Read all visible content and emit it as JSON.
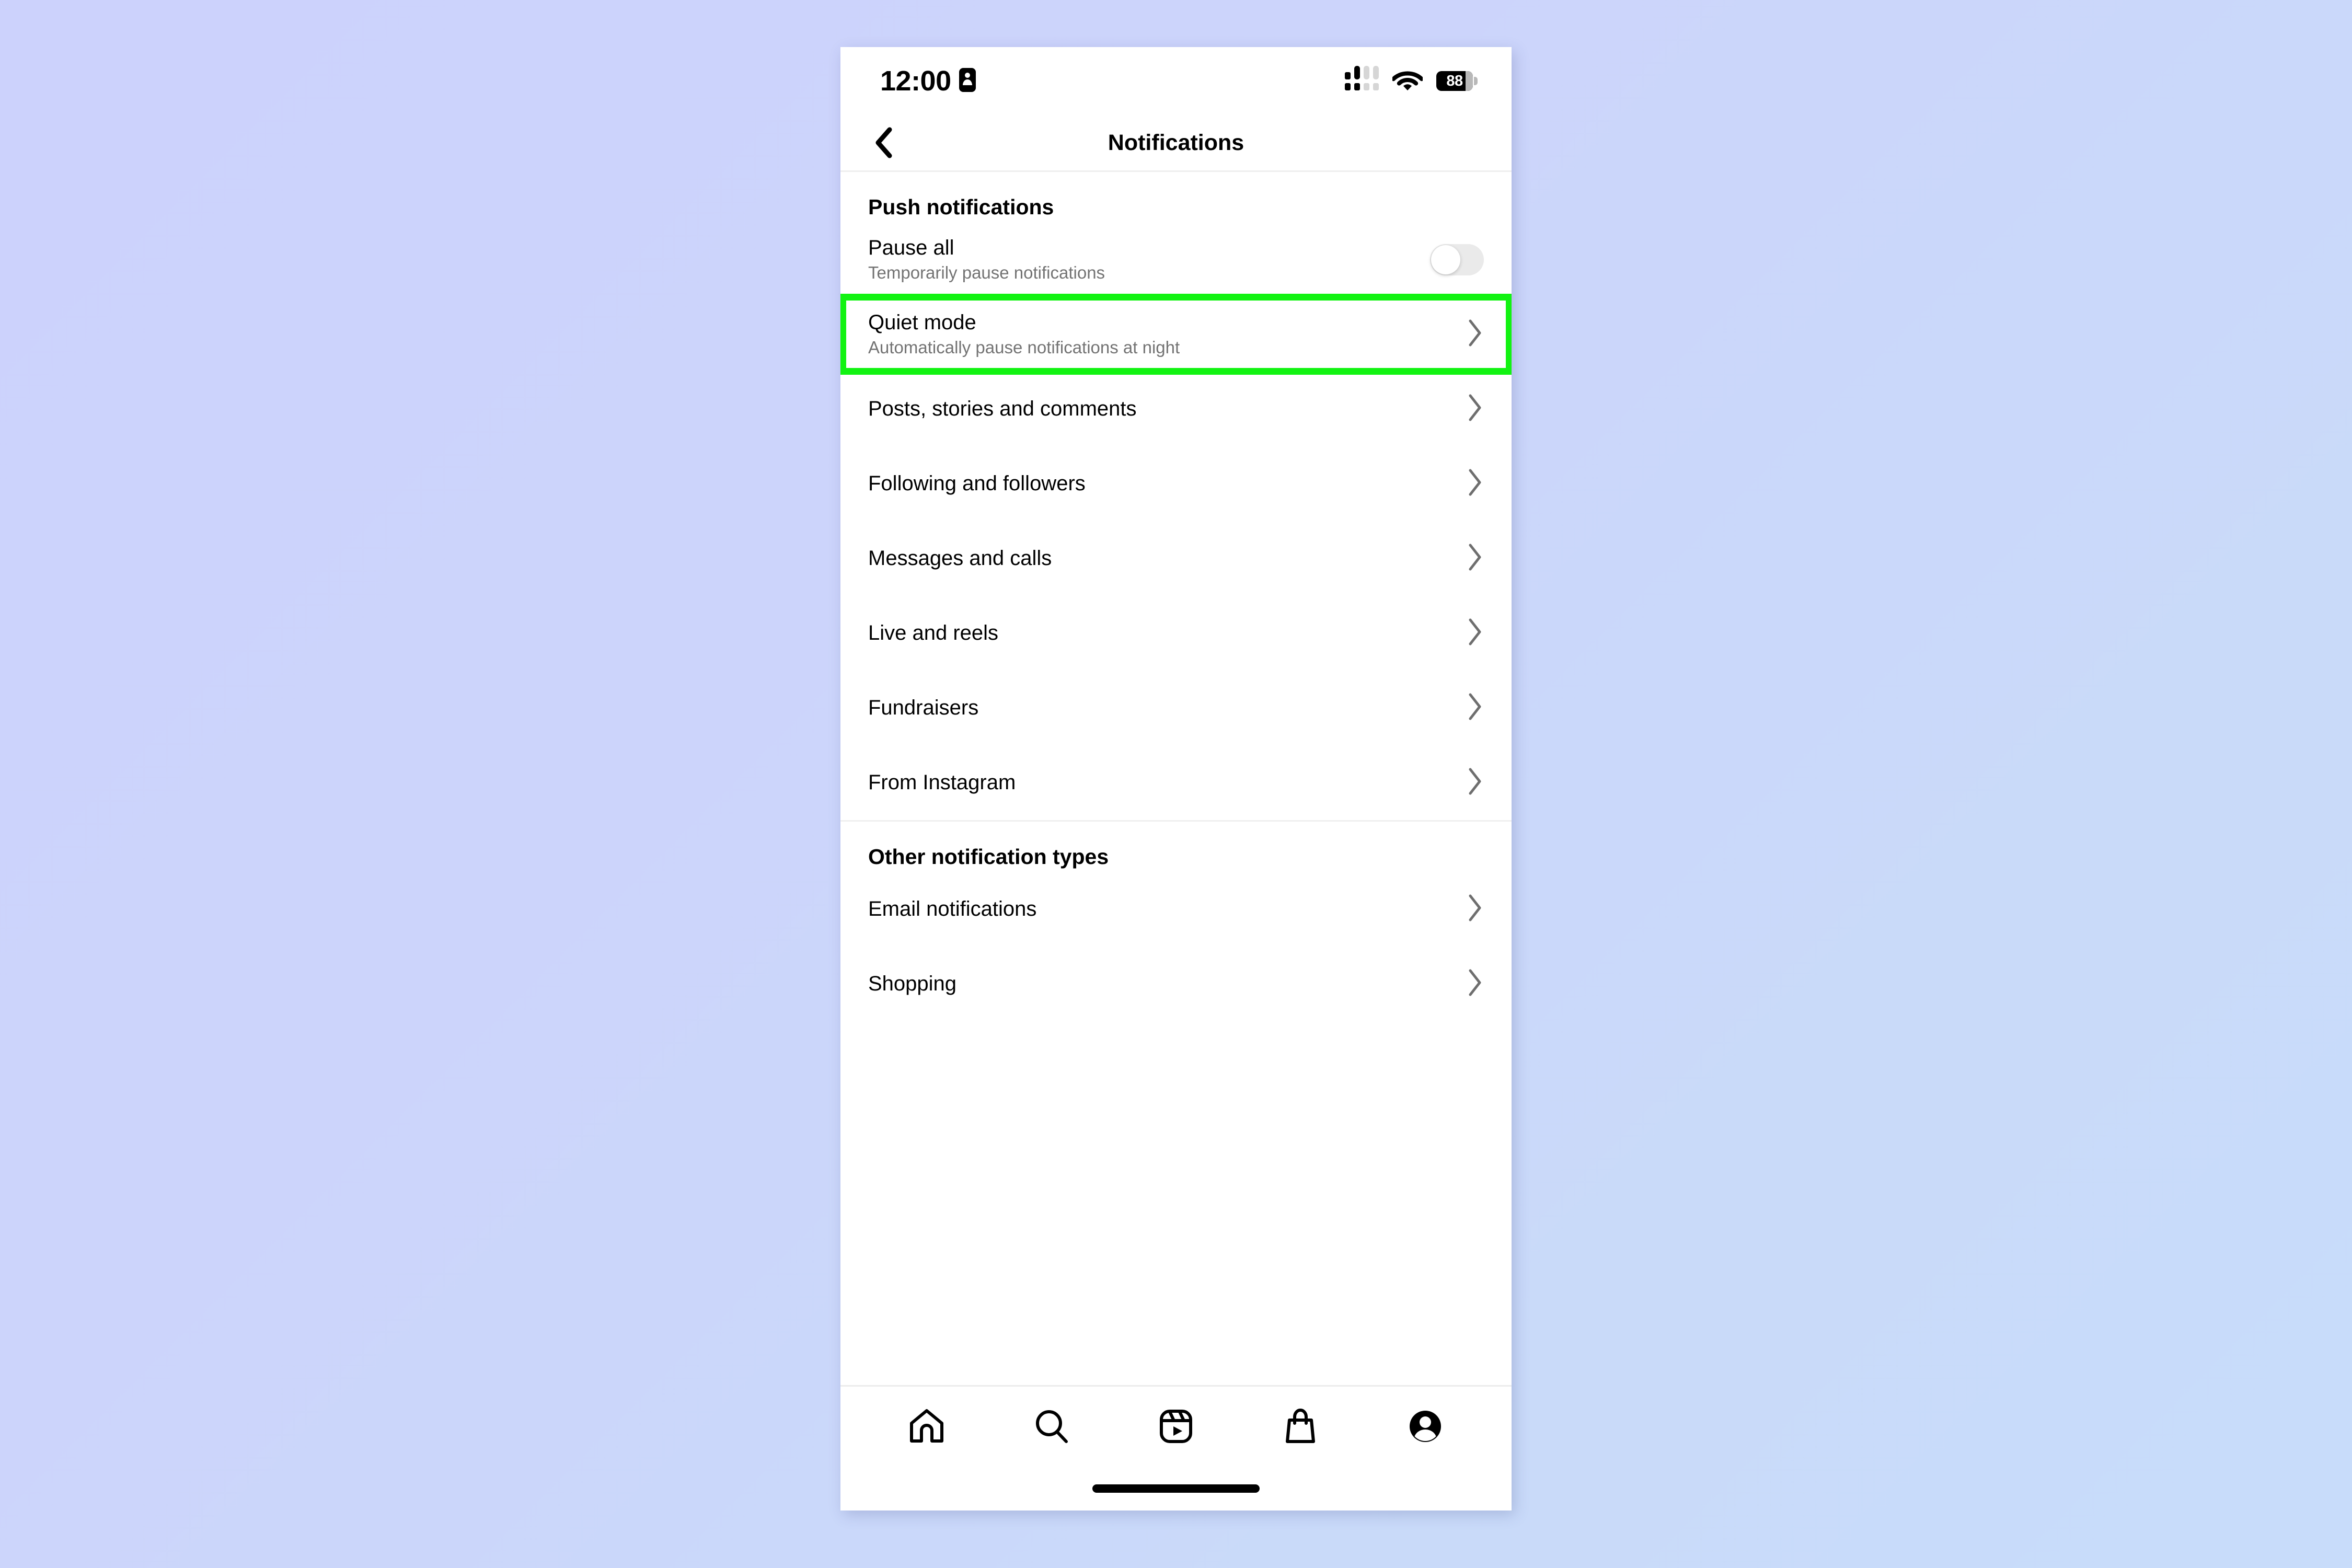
{
  "status_bar": {
    "time": "12:00",
    "time_icon": "alarm-badge-icon",
    "signal_icon": "cellular-signal-icon",
    "wifi_icon": "wifi-icon",
    "battery_level": "88",
    "battery_icon": "battery-icon"
  },
  "nav": {
    "back_icon": "chevron-left-icon",
    "title": "Notifications"
  },
  "sections": [
    {
      "header": "Push notifications",
      "rows": [
        {
          "title": "Pause all",
          "subtitle": "Temporarily pause notifications",
          "control": "toggle",
          "toggle_on": false
        },
        {
          "title": "Quiet mode",
          "subtitle": "Automatically pause notifications at night",
          "control": "chevron",
          "highlighted": true
        },
        {
          "title": "Posts, stories and comments",
          "subtitle": "",
          "control": "chevron"
        },
        {
          "title": "Following and followers",
          "subtitle": "",
          "control": "chevron"
        },
        {
          "title": "Messages and calls",
          "subtitle": "",
          "control": "chevron"
        },
        {
          "title": "Live and reels",
          "subtitle": "",
          "control": "chevron"
        },
        {
          "title": "Fundraisers",
          "subtitle": "",
          "control": "chevron"
        },
        {
          "title": "From Instagram",
          "subtitle": "",
          "control": "chevron"
        }
      ]
    },
    {
      "header": "Other notification types",
      "rows": [
        {
          "title": "Email notifications",
          "subtitle": "",
          "control": "chevron"
        },
        {
          "title": "Shopping",
          "subtitle": "",
          "control": "chevron"
        }
      ]
    }
  ],
  "tab_bar": {
    "items": [
      {
        "icon": "home-icon",
        "label": "Home",
        "active": false
      },
      {
        "icon": "search-icon",
        "label": "Search",
        "active": false
      },
      {
        "icon": "reels-icon",
        "label": "Reels",
        "active": false
      },
      {
        "icon": "shop-bag-icon",
        "label": "Shop",
        "active": false
      },
      {
        "icon": "profile-avatar-icon",
        "label": "Profile",
        "active": true
      }
    ]
  },
  "colors": {
    "highlight_green": "#12f312",
    "subtitle_gray": "#737373",
    "divider_gray": "#efefef",
    "toggle_track_off": "#eaeaea",
    "background_top": "#ccd2fc",
    "background_bottom": "#c8dcfa"
  }
}
